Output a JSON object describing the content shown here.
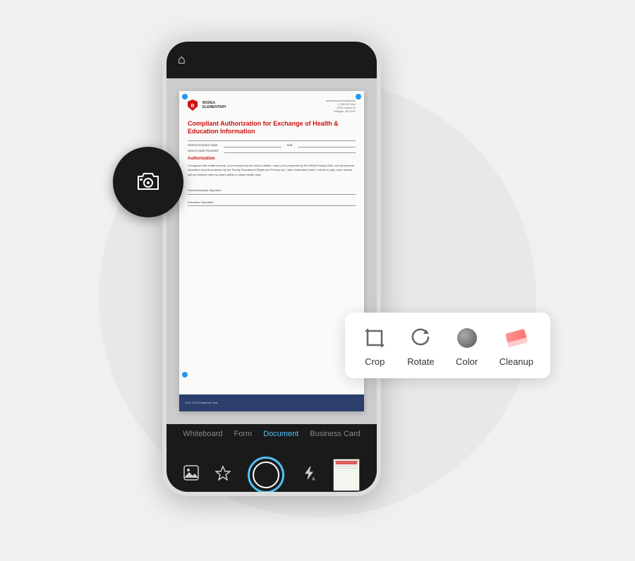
{
  "scene": {
    "phone": {
      "topBar": {
        "homeIcon": "⌂"
      },
      "document": {
        "schoolName": "BODEA\nELEMENTARY",
        "headerRight": "www.bodeaelementary.edu\n+1 555 000 5134\n2022 Campus Dr\nArlington, VA 22201",
        "title": "Compliant Authorization for Exchange of Health & Education Information",
        "fields": [
          {
            "label": "PATIENT/STUDENT NAME",
            "extraLabel": "DOB"
          },
          {
            "label": "HEALTH CARE PROVIDER"
          }
        ],
        "sectionTitle": "Authorization",
        "bodyText": "I recognize that health records, once received by the school district, may not be protected by the HIPAA Privacy Rule, but will become education records protected by the Family Educational Rights and Privacy Act. I also understand that if I refuse to sign, such refusal will not interfere with my child's ability to obtain health care.",
        "signatureFields": [
          "Parent/Guardian Signature",
          "Education Specialist"
        ],
        "footerText": "2021-2022 Academic Year"
      },
      "scanModes": [
        "Whiteboard",
        "Form",
        "Document",
        "Business Card"
      ],
      "activeScanMode": "Document"
    },
    "toolbar": {
      "items": [
        {
          "id": "crop",
          "label": "Crop"
        },
        {
          "id": "rotate",
          "label": "Rotate"
        },
        {
          "id": "color",
          "label": "Color"
        },
        {
          "id": "cleanup",
          "label": "Cleanup"
        }
      ]
    }
  }
}
